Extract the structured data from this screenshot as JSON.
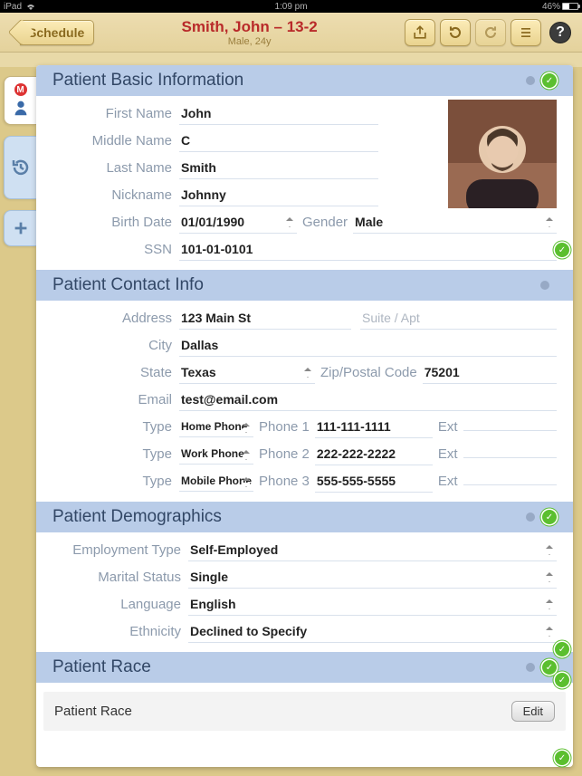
{
  "status": {
    "device": "iPad",
    "time": "1:09 pm",
    "battery": "46%"
  },
  "toolbar": {
    "back": "Schedule",
    "title": "Smith, John – 13-2",
    "subtitle": "Male, 24y",
    "help": "?"
  },
  "sections": {
    "basic": {
      "title": "Patient Basic Information",
      "fields": {
        "first_name_label": "First Name",
        "first_name": "John",
        "middle_name_label": "Middle Name",
        "middle_name": "C",
        "last_name_label": "Last Name",
        "last_name": "Smith",
        "nickname_label": "Nickname",
        "nickname": "Johnny",
        "birth_date_label": "Birth Date",
        "birth_date": "01/01/1990",
        "gender_label": "Gender",
        "gender": "Male",
        "ssn_label": "SSN",
        "ssn": "101-01-0101"
      }
    },
    "contact": {
      "title": "Patient Contact Info",
      "fields": {
        "address_label": "Address",
        "address": "123 Main St",
        "suite_label": "Suite / Apt",
        "suite": "",
        "city_label": "City",
        "city": "Dallas",
        "state_label": "State",
        "state": "Texas",
        "zip_label": "Zip/Postal Code",
        "zip": "75201",
        "email_label": "Email",
        "email": "test@email.com",
        "type_label": "Type",
        "phone1_label": "Phone 1",
        "phone2_label": "Phone 2",
        "phone3_label": "Phone 3",
        "ext_label": "Ext",
        "type1": "Home Phone",
        "phone1": "111-111-1111",
        "ext1": "",
        "type2": "Work Phone",
        "phone2": "222-222-2222",
        "ext2": "",
        "type3": "Mobile Phone",
        "phone3": "555-555-5555",
        "ext3": ""
      }
    },
    "demographics": {
      "title": "Patient Demographics",
      "fields": {
        "employment_label": "Employment Type",
        "employment": "Self-Employed",
        "marital_label": "Marital Status",
        "marital": "Single",
        "language_label": "Language",
        "language": "English",
        "ethnicity_label": "Ethnicity",
        "ethnicity": "Declined to Specify"
      }
    },
    "race": {
      "title": "Patient Race",
      "row_label": "Patient Race",
      "edit": "Edit"
    }
  }
}
